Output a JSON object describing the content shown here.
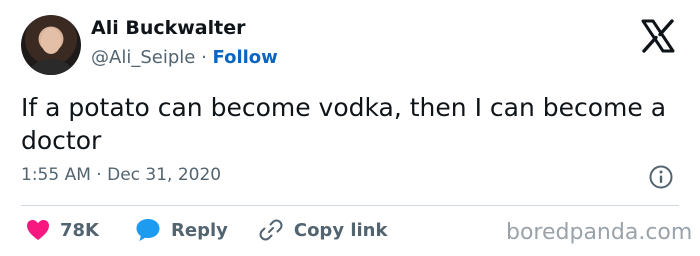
{
  "author": {
    "name": "Ali Buckwalter",
    "handle": "@Ali_Seiple",
    "separator": "·",
    "follow_label": "Follow"
  },
  "tweet": {
    "text": "If a potato can become vodka, then I can become a doctor",
    "time": "1:55 AM",
    "date": "Dec 31, 2020",
    "time_separator": "·"
  },
  "actions": {
    "likes": "78K",
    "reply_label": "Reply",
    "copy_label": "Copy link"
  },
  "watermark": "boredpanda.com",
  "icons": {
    "brand": "x-logo-icon",
    "info": "info-icon",
    "like": "heart-icon",
    "reply": "speech-bubble-icon",
    "copy": "link-icon"
  },
  "colors": {
    "like": "#f91880",
    "reply": "#1d9bf0",
    "follow": "#0a66c2",
    "muted": "#536471"
  }
}
